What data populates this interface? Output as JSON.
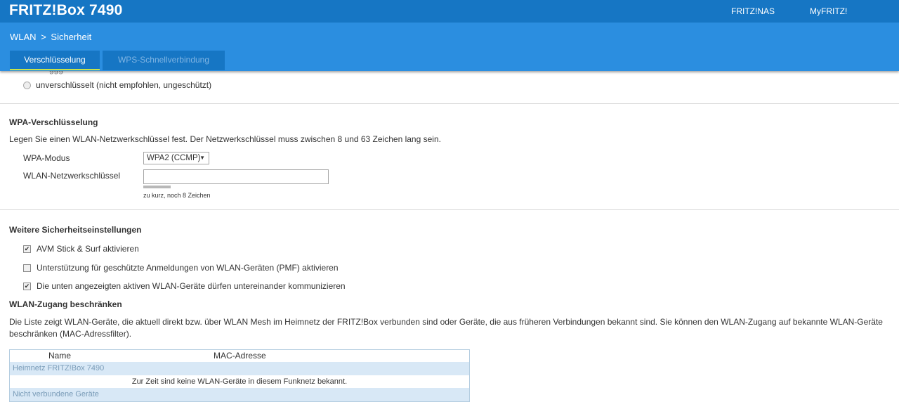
{
  "header": {
    "brand": "FRITZ!Box 7490",
    "links": [
      "FRITZ!NAS",
      "MyFRITZ!"
    ]
  },
  "breadcrumb": {
    "section": "WLAN",
    "separator": ">",
    "page": "Sicherheit"
  },
  "tabs": [
    {
      "label": "Verschlüsselung",
      "active": true
    },
    {
      "label": "WPS-Schnellverbindung",
      "active": false
    }
  ],
  "encryption_options": {
    "partially_hidden_option": "ggg",
    "unencrypted_label": "unverschlüsselt (nicht empfohlen, ungeschützt)"
  },
  "wpa": {
    "heading": "WPA-Verschlüsselung",
    "description": "Legen Sie einen WLAN-Netzwerkschlüssel fest. Der Netzwerkschlüssel muss zwischen 8 und 63 Zeichen lang sein.",
    "mode_label": "WPA-Modus",
    "mode_value": "WPA2 (CCMP)",
    "key_label": "WLAN-Netzwerkschlüssel",
    "key_value": "",
    "strength_hint": "zu kurz, noch 8 Zeichen"
  },
  "security": {
    "heading": "Weitere Sicherheitseinstellungen",
    "options": [
      {
        "label": "AVM Stick & Surf aktivieren",
        "checked": true
      },
      {
        "label": "Unterstützung für geschützte Anmeldungen von WLAN-Geräten (PMF) aktivieren",
        "checked": false
      },
      {
        "label": "Die unten angezeigten aktiven WLAN-Geräte dürfen untereinander kommunizieren",
        "checked": true
      }
    ]
  },
  "access": {
    "heading": "WLAN-Zugang beschränken",
    "description_line1": "Die Liste zeigt WLAN-Geräte, die aktuell direkt bzw. über WLAN Mesh im Heimnetz der FRITZ!Box verbunden sind oder Geräte, die aus früheren Verbindungen bekannt sind. Sie können den WLAN-Zugang auf bekannte WLAN-Geräte",
    "description_line2": "beschränken (MAC-Adressfilter).",
    "table": {
      "columns": [
        "Name",
        "MAC-Adresse"
      ],
      "group": "Heimnetz FRITZ!Box 7490",
      "empty_message": "Zur Zeit sind keine WLAN-Geräte in diesem Funknetz bekannt.",
      "group2": "Nicht verbundene Geräte"
    }
  },
  "colors": {
    "topbar": "#1676c4",
    "subbar": "#2b8ee0",
    "tab_underline": "#c7e34a",
    "table_group": "#d8e8f6"
  }
}
